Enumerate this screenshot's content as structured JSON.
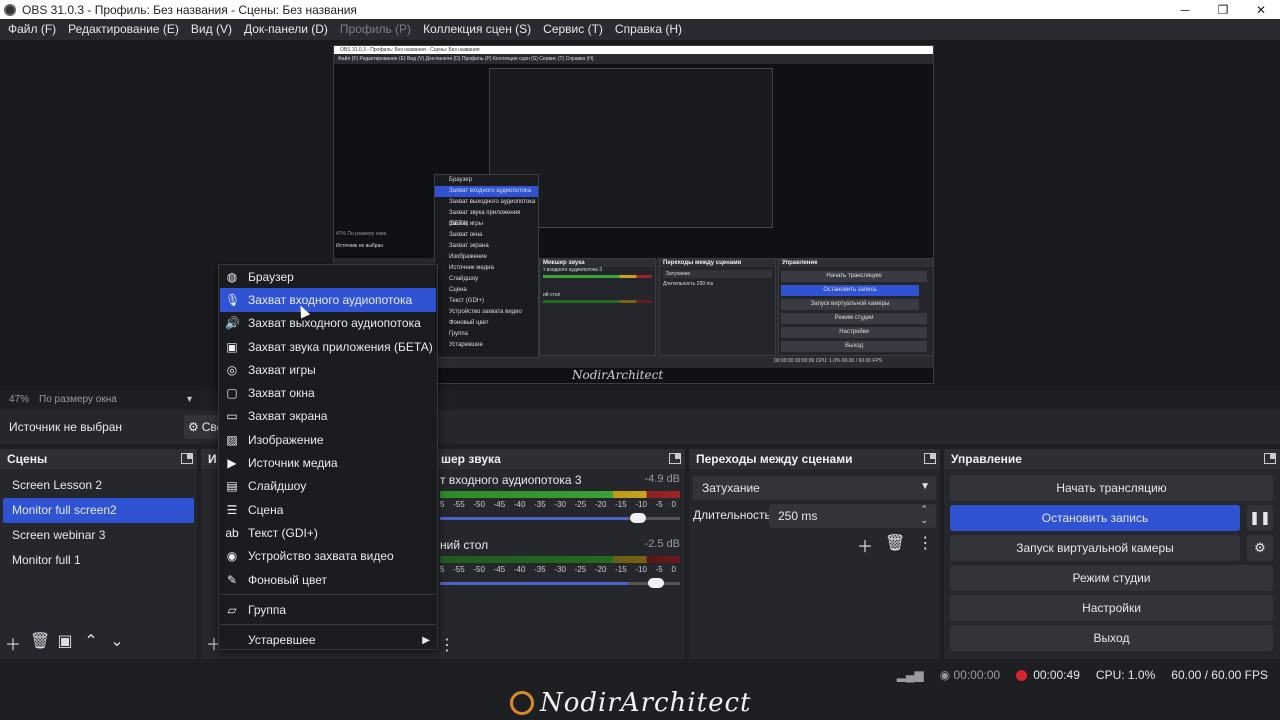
{
  "window": {
    "title": "OBS 31.0.3 - Профиль: Без названия - Сцены: Без названия",
    "min": "─",
    "max": "❐",
    "close": "✕"
  },
  "menu": [
    "Файл (F)",
    "Редактирование (E)",
    "Вид (V)",
    "Док-панели (D)",
    "Профиль (P)",
    "Коллекция сцен (S)",
    "Сервис (T)",
    "Справка (H)"
  ],
  "preview": {
    "zoom": "47%",
    "fit": "По размеру окна",
    "watermark": "NodirArchitect"
  },
  "source_bar": {
    "no_source": "Источник не выбран",
    "properties": "Сво"
  },
  "scenes": {
    "title": "Сцены",
    "items": [
      "Screen Lesson 2",
      "Monitor  full screen2",
      "Screen webinar  3",
      "Monitor   full 1"
    ],
    "selected": 1
  },
  "sources": {
    "title": "И"
  },
  "mixer": {
    "title": "шер звука",
    "channels": [
      {
        "name": "т входного аудиопотока 3",
        "db": "-4.9 dB",
        "level": 0.86,
        "volume": 0.85
      },
      {
        "name": "ний стол",
        "db": "-2.5 dB",
        "level": 0.72,
        "volume": 0.93
      }
    ],
    "ticks": [
      "5",
      "-55",
      "-50",
      "-45",
      "-40",
      "-35",
      "-30",
      "-25",
      "-20",
      "-15",
      "-10",
      "-5",
      "0"
    ]
  },
  "transitions": {
    "title": "Переходы между сценами",
    "selected": "Затухание",
    "duration_label": "Длительность",
    "duration": "250 ms"
  },
  "controls": {
    "title": "Управление",
    "buttons": [
      "Начать трансляцию",
      "Остановить запись",
      "Запуск виртуальной камеры",
      "Режим студии",
      "Настройки",
      "Выход"
    ]
  },
  "status": {
    "stream_time": "00:00:00",
    "rec_time": "00:00:49",
    "cpu": "CPU: 1.0%",
    "fps": "60.00 / 60.00 FPS"
  },
  "context_menu": {
    "items": [
      {
        "label": "Браузер",
        "icon": "globe-icon",
        "glyph": "◍"
      },
      {
        "label": "Захват входного аудиопотока",
        "icon": "microphone-icon",
        "glyph": "🎙"
      },
      {
        "label": "Захват выходного аудиопотока",
        "icon": "speaker-icon",
        "glyph": "🔊"
      },
      {
        "label": "Захват звука приложения (БЕТА)",
        "icon": "app-audio-icon",
        "glyph": "▣"
      },
      {
        "label": "Захват игры",
        "icon": "gamepad-icon",
        "glyph": "◎"
      },
      {
        "label": "Захват окна",
        "icon": "window-icon",
        "glyph": "▢"
      },
      {
        "label": "Захват экрана",
        "icon": "monitor-icon",
        "glyph": "▭"
      },
      {
        "label": "Изображение",
        "icon": "image-icon",
        "glyph": "▨"
      },
      {
        "label": "Источник медиа",
        "icon": "play-icon",
        "glyph": "▶"
      },
      {
        "label": "Слайдшоу",
        "icon": "slideshow-icon",
        "glyph": "▤"
      },
      {
        "label": "Сцена",
        "icon": "list-icon",
        "glyph": "☰"
      },
      {
        "label": "Текст (GDI+)",
        "icon": "text-icon",
        "glyph": "ab"
      },
      {
        "label": "Устройство захвата видео",
        "icon": "camera-icon",
        "glyph": "◉"
      },
      {
        "label": "Фоновый цвет",
        "icon": "brush-icon",
        "glyph": "✎"
      },
      {
        "label": "Группа",
        "icon": "folder-icon",
        "glyph": "▱"
      },
      {
        "label": "Устаревшее",
        "icon": "",
        "glyph": ""
      }
    ],
    "selected": 1
  },
  "nested": {
    "title": "OBS 31.0.3 - Профиль: Без названия - Сцены: Без названия",
    "menu": "Файл (F)   Редактирование (E)   Вид (V)   Док-панели (D)   Профиль (P)   Коллекция сцен (S)   Сервис (T)   Справка (H)",
    "zoom": "47%   По размеру окна",
    "no_source": "Источник не выбран",
    "mixer_title": "Микшер звука",
    "trans_title": "Переходы между сценами",
    "ctrl_title": "Управление",
    "fade": "Затухание",
    "duration": "Длительность   250 ms",
    "ch1": "т входного аудиопотока 3",
    "ch1_db": "-4.6 dB",
    "ch2": "ий стол",
    "ctrl_buttons": [
      "Начать трансляцию",
      "Остановить запись",
      "Запуск виртуальной камеры",
      "Режим студии",
      "Настройки",
      "Выход"
    ],
    "status": "00:00:00   00:00:09   CPU: 1.0%   60.00 / 60.00 FPS",
    "menu_items": [
      "Браузер",
      "Захват входного аудиопотока",
      "Захват выходного аудиопотока",
      "Захват звука приложения (БЕТА)",
      "Захват игры",
      "Захват окна",
      "Захват экрана",
      "Изображение",
      "Источник медиа",
      "Слайдшоу",
      "Сцена",
      "Текст (GDI+)",
      "Устройство захвата видео",
      "Фоновый цвет",
      "Группа",
      "Устаревшее"
    ]
  },
  "colors": {
    "accent": "#2f53d2",
    "background": "#1e1f23",
    "panel": "#26272c",
    "rec": "#d8262f"
  }
}
